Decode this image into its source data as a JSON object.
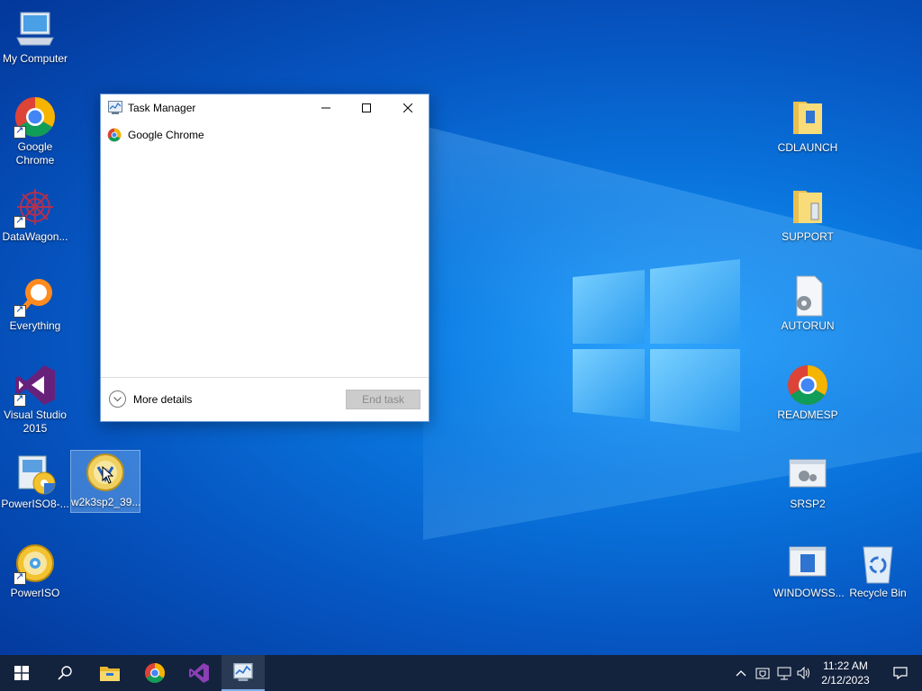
{
  "desktop": {
    "left_icons": [
      {
        "label": "My Computer",
        "icon": "computer-icon",
        "shortcut": false
      },
      {
        "label": "Google Chrome",
        "icon": "chrome-icon",
        "shortcut": true
      },
      {
        "label": "DataWagon...",
        "icon": "datawagon-icon",
        "shortcut": true
      },
      {
        "label": "Everything",
        "icon": "everything-search-icon",
        "shortcut": true
      },
      {
        "label": "Visual Studio 2015",
        "icon": "visual-studio-icon",
        "shortcut": true
      },
      {
        "label": "PowerISO8-...",
        "icon": "poweriso-installer-icon",
        "shortcut": false
      },
      {
        "label": "w2k3sp2_39...",
        "icon": "disc-image-icon",
        "shortcut": false,
        "selected": true
      },
      {
        "label": "PowerISO",
        "icon": "poweriso-icon",
        "shortcut": true
      }
    ],
    "right_icons": [
      {
        "label": "CDLAUNCH",
        "icon": "folder-icon"
      },
      {
        "label": "SUPPORT",
        "icon": "folder-icon"
      },
      {
        "label": "AUTORUN",
        "icon": "settings-file-icon"
      },
      {
        "label": "READMESP",
        "icon": "chrome-icon"
      },
      {
        "label": "SRSP2",
        "icon": "settings-window-icon"
      },
      {
        "label": "WINDOWSS...",
        "icon": "window-file-icon"
      },
      {
        "label": "Recycle Bin",
        "icon": "recycle-bin-icon"
      }
    ]
  },
  "task_manager": {
    "title": "Task Manager",
    "processes": [
      {
        "name": "Google Chrome",
        "icon": "chrome-icon"
      }
    ],
    "more_details_label": "More details",
    "end_task_label": "End task",
    "end_task_enabled": false
  },
  "taskbar": {
    "items": [
      "start-icon",
      "search-icon",
      "file-explorer-icon",
      "chrome-icon",
      "visual-studio-icon",
      "task-manager-icon"
    ],
    "active_item": "task-manager-icon",
    "tray_icons": [
      "chevron-up-icon",
      "security-icon",
      "network-icon",
      "volume-icon"
    ],
    "time": "11:22 AM",
    "date": "2/12/2023"
  },
  "colors": {
    "desktop_blue": "#0a78e0",
    "taskbar": "#13223d",
    "window_border": "#6c9dd8"
  }
}
